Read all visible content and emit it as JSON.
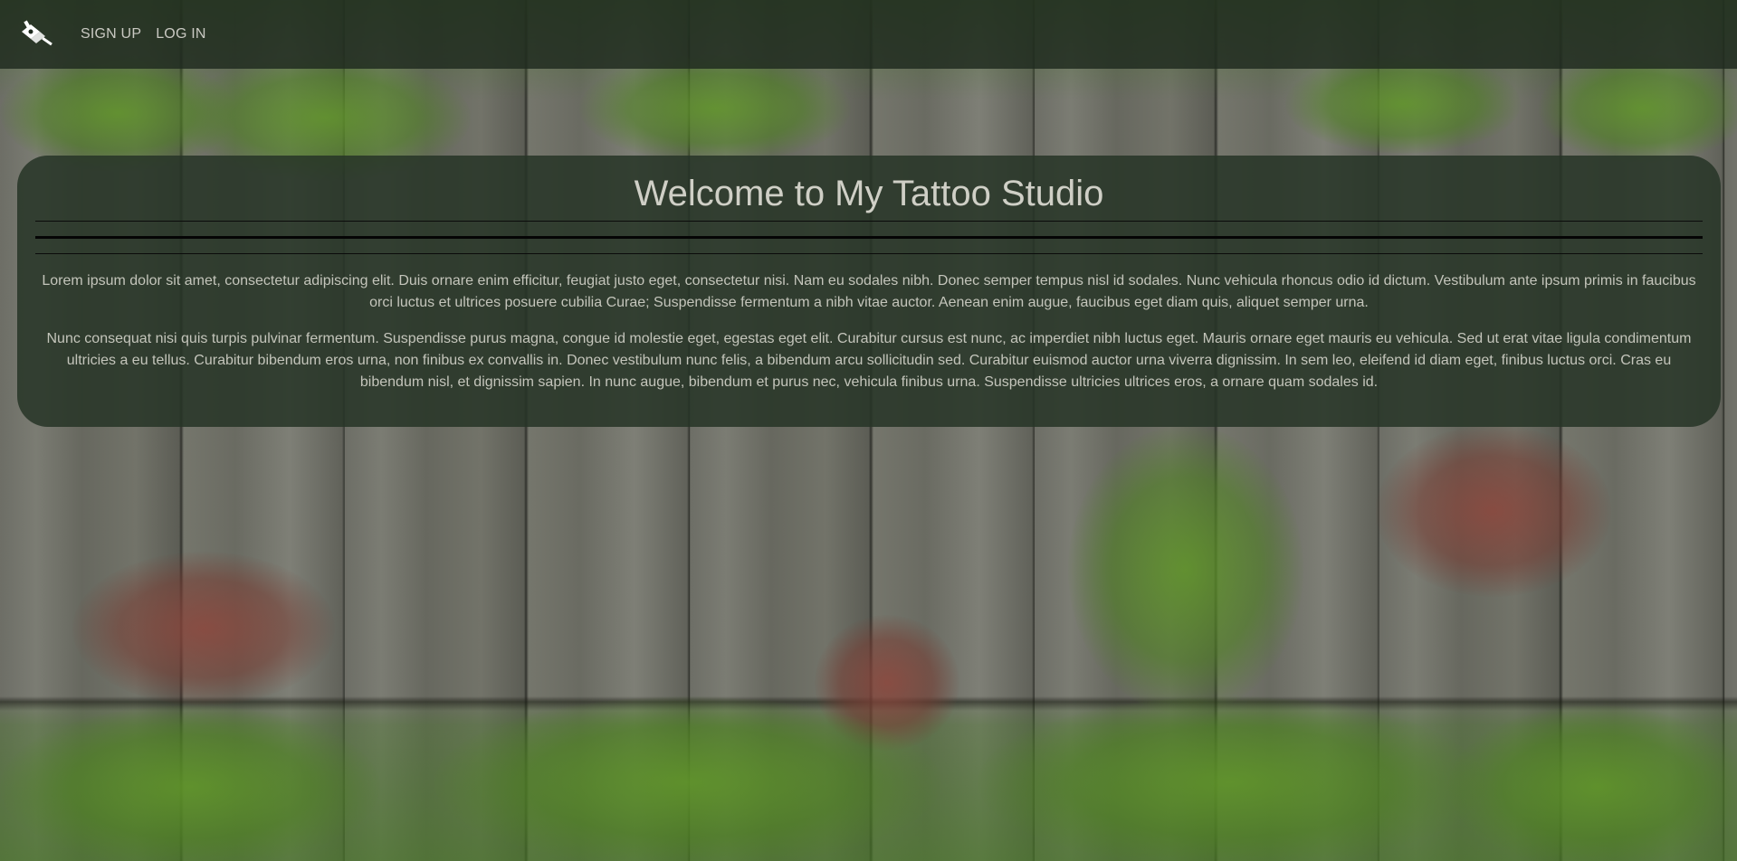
{
  "nav": {
    "logo_icon": "tattoo-machine-icon",
    "links": [
      {
        "label": "SIGN UP"
      },
      {
        "label": "LOG IN"
      }
    ]
  },
  "main": {
    "title": "Welcome to My Tattoo Studio",
    "paragraphs": [
      "Lorem ipsum dolor sit amet, consectetur adipiscing elit. Duis ornare enim efficitur, feugiat justo eget, consectetur nisi. Nam eu sodales nibh. Donec semper tempus nisl id sodales. Nunc vehicula rhoncus odio id dictum. Vestibulum ante ipsum primis in faucibus orci luctus et ultrices posuere cubilia Curae; Suspendisse fermentum a nibh vitae auctor. Aenean enim augue, faucibus eget diam quis, aliquet semper urna.",
      "Nunc consequat nisi quis turpis pulvinar fermentum. Suspendisse purus magna, congue id molestie eget, egestas eget elit. Curabitur cursus est nunc, ac imperdiet nibh luctus eget. Mauris ornare eget mauris eu vehicula. Sed ut erat vitae ligula condimentum ultricies a eu tellus. Curabitur bibendum eros urna, non finibus ex convallis in. Donec vestibulum nunc felis, a bibendum arcu sollicitudin sed. Curabitur euismod auctor urna viverra dignissim. In sem leo, eleifend id diam eget, finibus luctus orci. Cras eu bibendum nisl, et dignissim sapien. In nunc augue, bibendum et purus nec, vehicula finibus urna. Suspendisse ultricies ultrices eros, a ornare quam sodales id."
    ]
  },
  "colors": {
    "navbar_bg": "#1e2a1e",
    "panel_bg": "#263426",
    "text": "#c4c5bb",
    "title": "#cfcfc6"
  }
}
